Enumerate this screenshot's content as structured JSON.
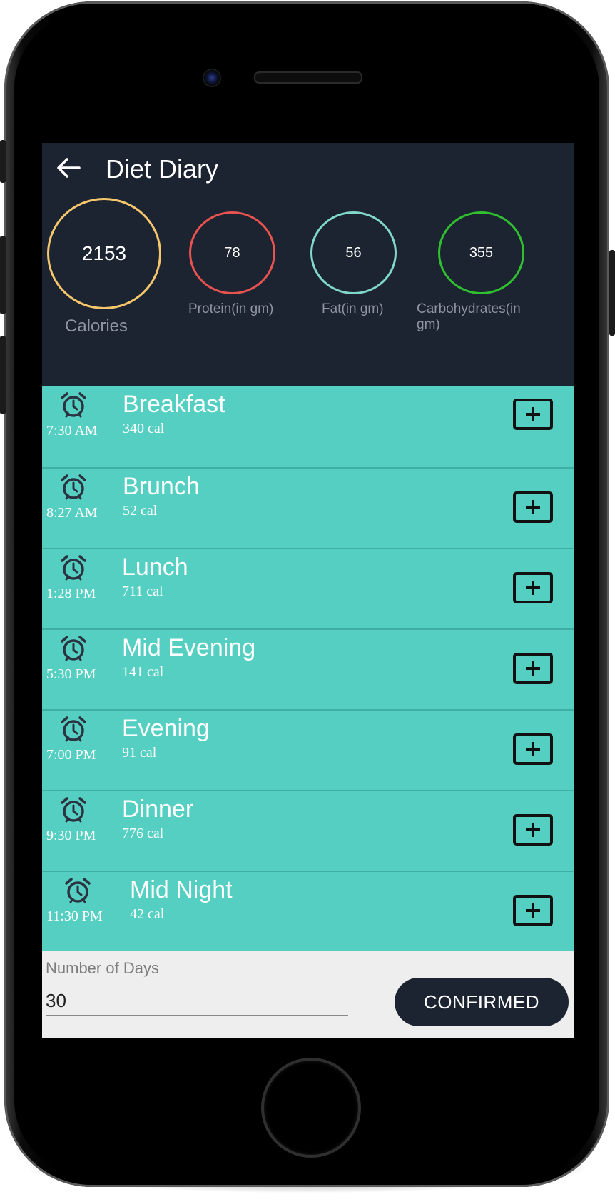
{
  "app": {
    "title": "Diet Diary"
  },
  "summary": {
    "calories": {
      "value": "2153",
      "label": "Calories",
      "color": "#f6c66c"
    },
    "protein": {
      "value": "78",
      "label": "Protein(in gm)",
      "color": "#e8524f"
    },
    "fat": {
      "value": "56",
      "label": "Fat(in gm)",
      "color": "#7fd8c8"
    },
    "carbs": {
      "value": "355",
      "label_line1": "Carbohydrates(in",
      "label_line2": "gm)",
      "color": "#2fbf2f"
    }
  },
  "meals": [
    {
      "time": "7:30 AM",
      "name": "Breakfast",
      "calories": "340 cal"
    },
    {
      "time": "8:27 AM",
      "name": "Brunch",
      "calories": "52 cal"
    },
    {
      "time": "1:28 PM",
      "name": "Lunch",
      "calories": "711 cal"
    },
    {
      "time": "5:30 PM",
      "name": "Mid Evening",
      "calories": "141 cal"
    },
    {
      "time": "7:00 PM",
      "name": "Evening",
      "calories": "91 cal"
    },
    {
      "time": "9:30 PM",
      "name": "Dinner",
      "calories": "776 cal"
    },
    {
      "time": "11:30 PM",
      "name": "Mid Night",
      "calories": "42 cal"
    }
  ],
  "footer": {
    "days_label": "Number of Days",
    "days_value": "30",
    "confirm_label": "CONFIRMED"
  },
  "colors": {
    "header_bg": "#1c2331",
    "meal_bg": "#56cfc3",
    "footer_bg": "#eeeeee"
  },
  "icons": {
    "back": "arrow-left-icon",
    "alarm": "alarm-clock-icon",
    "add": "plus-square-icon"
  }
}
